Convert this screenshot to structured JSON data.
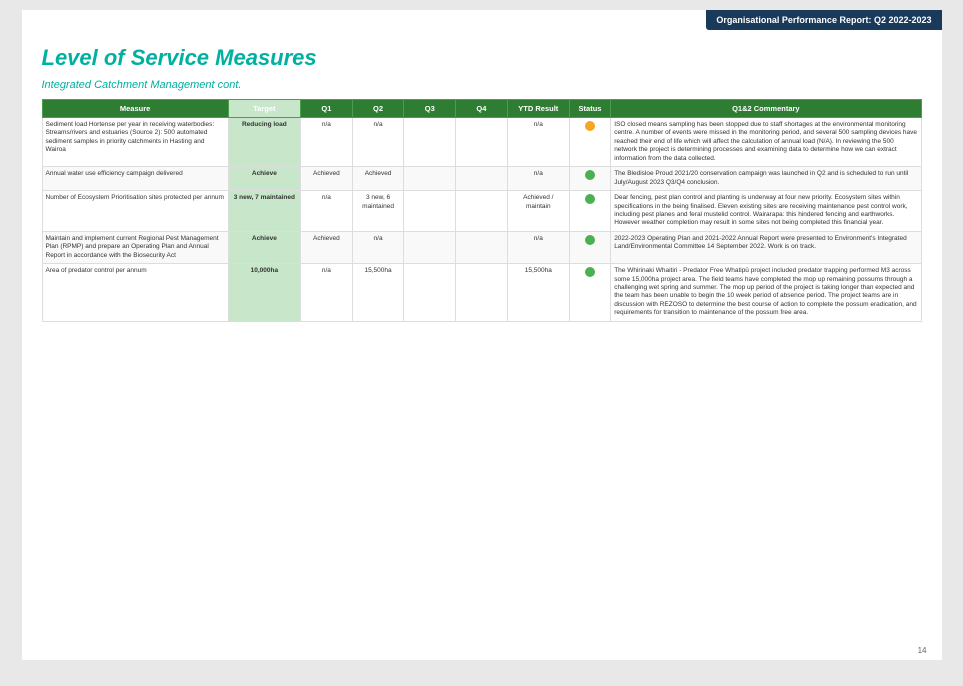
{
  "badge": "Organisational Performance Report: Q2 2022-2023",
  "title": "Level of Service Measures",
  "section": "Integrated Catchment Management cont.",
  "page_num": "14",
  "table": {
    "headers": [
      "Measure",
      "Target",
      "Q1",
      "Q2",
      "Q3",
      "Q4",
      "YTD Result",
      "Status",
      "Q1&2 Commentary"
    ],
    "rows": [
      {
        "measure": "Sediment load Hortense per year in receiving waterbodies: Streams/rivers and estuaries (Source 2): 500 automated sediment samples in priority catchments in Hasting and Wairoa",
        "target": "Reducing load",
        "q1": "n/a",
        "q2": "n/a",
        "q3": "",
        "q4": "",
        "ytd": "n/a",
        "status": "amber",
        "commentary": "ISO closed means sampling has been stopped due to staff shortages at the environmental monitoring centre. A number of events were missed in the monitoring period, and several 500 sampling devices have reached their end of life which will affect the calculation of annual load (N/A). In reviewing the 500 network the project is determining processes and examining data to determine how we can extract information from the data collected."
      },
      {
        "measure": "Annual water use efficiency campaign delivered",
        "target": "Achieve",
        "q1": "Achieved",
        "q2": "Achieved",
        "q3": "",
        "q4": "",
        "ytd": "n/a",
        "status": "green",
        "commentary": "The Bledisloe Proud 2021/20 conservation campaign was launched in Q2 and is scheduled to run until July/August 2023 Q3/Q4 conclusion."
      },
      {
        "measure": "Number of Ecosystem Prioritisation sites protected per annum",
        "target": "3 new, 7 maintained",
        "q1": "n/a",
        "q2": "3 new, 6 maintained",
        "q3": "",
        "q4": "",
        "ytd": "Achieved / maintain",
        "status": "green",
        "commentary": "Dear fencing, pest plan control and planting is underway at four new priority. Ecosystem sites within specifications in the being finalised. Eleven existing sites are receiving maintenance pest control work, including pest planes and feral mustelid control. Wairarapa: this hindered fencing and earthworks. However weather completion may result in some sites not being completed this financial year."
      },
      {
        "measure": "Maintain and implement current Regional Pest Management Plan (RPMP) and prepare an Operating Plan and Annual Report in accordance with the Biosecurity Act",
        "target": "Achieve",
        "q1": "Achieved",
        "q2": "n/a",
        "q3": "",
        "q4": "",
        "ytd": "n/a",
        "status": "green",
        "commentary": "2022-2023 Operating Plan and 2021-2022 Annual Report were presented to Environment's Integrated Land/Environmental Committee 14 September 2022. Work is on track."
      },
      {
        "measure": "Area of predator control per annum",
        "target": "10,000ha",
        "q1": "n/a",
        "q2": "15,500ha",
        "q3": "",
        "q4": "",
        "ytd": "15,500ha",
        "status": "green",
        "commentary": "The Whirinaki Whaitiri - Predator Free Whatipū project included predator trapping performed M3 across some 15,000ha project area. The field teams have completed the mop up remaining possums through a challenging wet spring and summer. The mop up period of the project is taking longer than expected and the team has been unable to begin the 10 week period of absence period. The project teams are in discussion with REZOSO to determine the best course of action to complete the possum eradication, and requirements for transition to maintenance of the possum free area."
      }
    ]
  }
}
